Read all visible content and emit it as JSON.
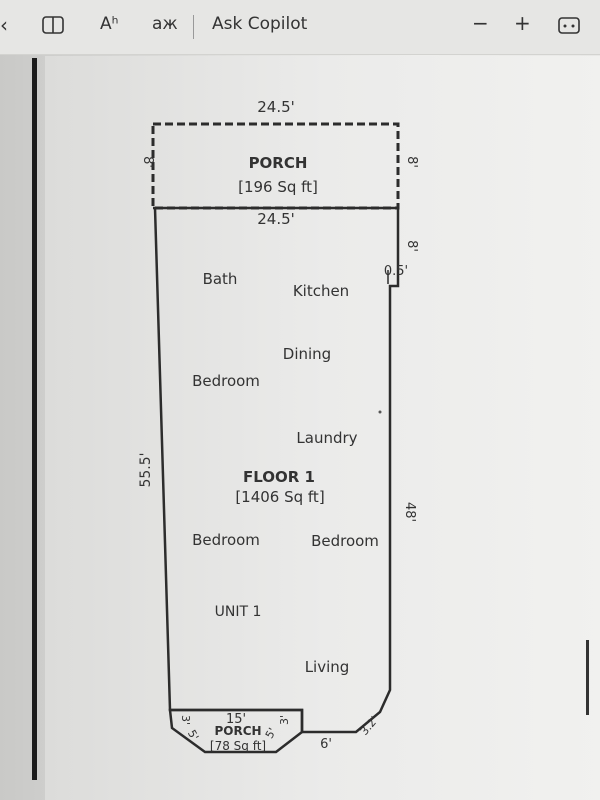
{
  "toolbar": {
    "aa": "Aʰ",
    "translate": "aж",
    "ask": "Ask Copilot",
    "minus": "−",
    "plus": "+"
  },
  "floorplan": {
    "porch_top": {
      "width": "24.5'",
      "side_left": "8'",
      "side_right": "8'",
      "name": "PORCH",
      "area": "[196 Sq ft]",
      "inner": "24.5'"
    },
    "main": {
      "top": "24.5'",
      "left": "55.5'",
      "right_top": "8'",
      "jog": "0.5'",
      "right": "48'",
      "name": "FLOOR 1",
      "area": "[1406 Sq ft]",
      "unit": "UNIT 1",
      "rooms": {
        "bath": "Bath",
        "kitchen": "Kitchen",
        "dining": "Dining",
        "bedroom1": "Bedroom",
        "laundry": "Laundry",
        "bedroom2": "Bedroom",
        "bedroom3": "Bedroom",
        "living": "Living"
      },
      "bottom_right": "6'",
      "corner": "3.2'"
    },
    "porch_bottom": {
      "width": "15'",
      "left_a": "3'",
      "left_b": "5'",
      "right_a": "3'",
      "right_b": "5'",
      "name": "PORCH",
      "area": "[78 Sq ft]"
    }
  }
}
